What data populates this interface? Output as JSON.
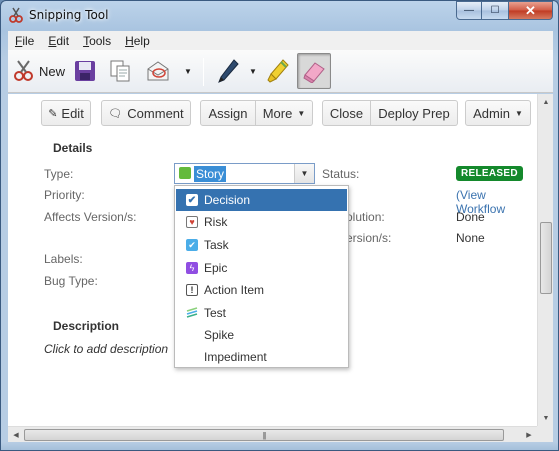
{
  "window": {
    "title": "Snipping Tool",
    "minimize_glyph": "—",
    "maximize_glyph": "☐",
    "close_glyph": "✕"
  },
  "menubar": {
    "items": [
      {
        "label": "File",
        "accel": "F",
        "rest": "ile"
      },
      {
        "label": "Edit",
        "accel": "E",
        "rest": "dit"
      },
      {
        "label": "Tools",
        "accel": "T",
        "rest": "ools"
      },
      {
        "label": "Help",
        "accel": "H",
        "rest": "elp"
      }
    ]
  },
  "toolbar": {
    "new_label": "New",
    "icons": [
      "scissors-icon",
      "save-icon",
      "copy-icon",
      "send-email-icon",
      "pen-icon",
      "highlighter-icon",
      "eraser-icon"
    ]
  },
  "actions": {
    "edit": "Edit",
    "comment": "Comment",
    "assign": "Assign",
    "more": "More",
    "close": "Close",
    "deploy_prep": "Deploy Prep",
    "admin": "Admin"
  },
  "details": {
    "title": "Details",
    "type_label": "Type:",
    "type_value": "Story",
    "priority_label": "Priority:",
    "affects_label": "Affects Version/s:",
    "labels_label": "Labels:",
    "bugtype_label": "Bug Type:",
    "status_label": "Status:",
    "status_value": "RELEASED",
    "workflow_prefix": "(",
    "workflow_link": "View Workflow",
    "resolution_label_partial": "olution:",
    "resolution_value": "Done",
    "fix_label_partial": "ersion/s:",
    "fix_value": "None"
  },
  "description": {
    "title": "Description",
    "placeholder": "Click to add description"
  },
  "type_dropdown": {
    "options": [
      {
        "label": "Decision",
        "icon": "decision-check-icon",
        "color": "#3b8c3b",
        "selected": true
      },
      {
        "label": "Risk",
        "icon": "risk-heart-icon",
        "color": "#d04437",
        "selected": false
      },
      {
        "label": "Task",
        "icon": "task-check-icon",
        "color": "#4bade8",
        "selected": false
      },
      {
        "label": "Epic",
        "icon": "epic-bolt-icon",
        "color": "#904ee2",
        "selected": false
      },
      {
        "label": "Action Item",
        "icon": "action-item-exclamation-icon",
        "color": "#555555",
        "selected": false
      },
      {
        "label": "Test",
        "icon": "test-lines-icon",
        "color": "#3ab08a",
        "selected": false
      },
      {
        "label": "Spike",
        "icon": "",
        "color": "",
        "selected": false
      },
      {
        "label": "Impediment",
        "icon": "",
        "color": "",
        "selected": false
      }
    ]
  },
  "colors": {
    "selected_bg": "#3572b0",
    "released_badge": "#14892c",
    "link": "#3b73af",
    "story_icon": "#63ba3c"
  }
}
